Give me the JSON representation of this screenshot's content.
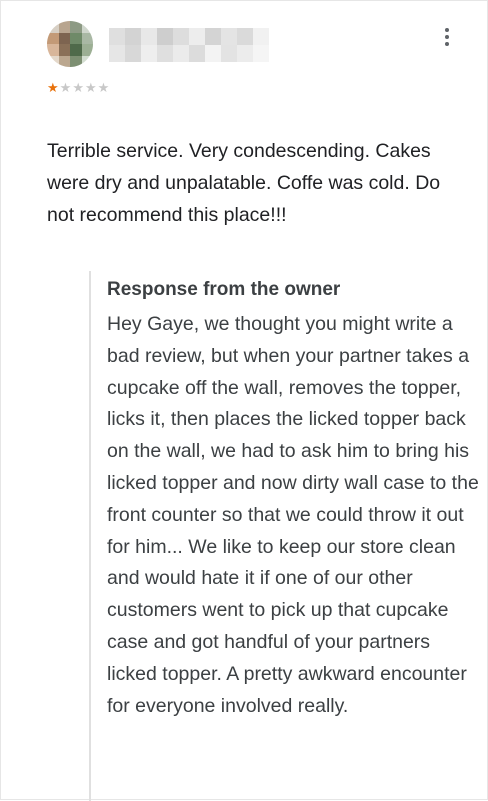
{
  "review": {
    "rating": 1,
    "max_rating": 5,
    "star_filled": "★",
    "star_empty": "★",
    "text": "Terrible service. Very condescending. Cakes were dry and unpalatable. Coffe was cold. Do not recommend this place!!!"
  },
  "response": {
    "title": "Response from the owner",
    "text": "Hey Gaye, we thought you might write a bad review, but when your partner takes a cupcake off the wall, removes the topper, licks it, then places the licked topper back on the wall, we had to ask him to bring his licked topper and now dirty wall case to the front counter so that we could throw it out for him... We like to keep our store clean and would hate it if one of our other customers went to pick up that cupcake case and got handful of your partners licked topper. A pretty awkward encounter for everyone involved really."
  },
  "colors": {
    "star_filled": "#e8710a",
    "star_empty": "#c8c8c8",
    "text": "#202124",
    "border": "#e0e0e0"
  },
  "icons": {
    "menu": "more-vert-icon"
  }
}
